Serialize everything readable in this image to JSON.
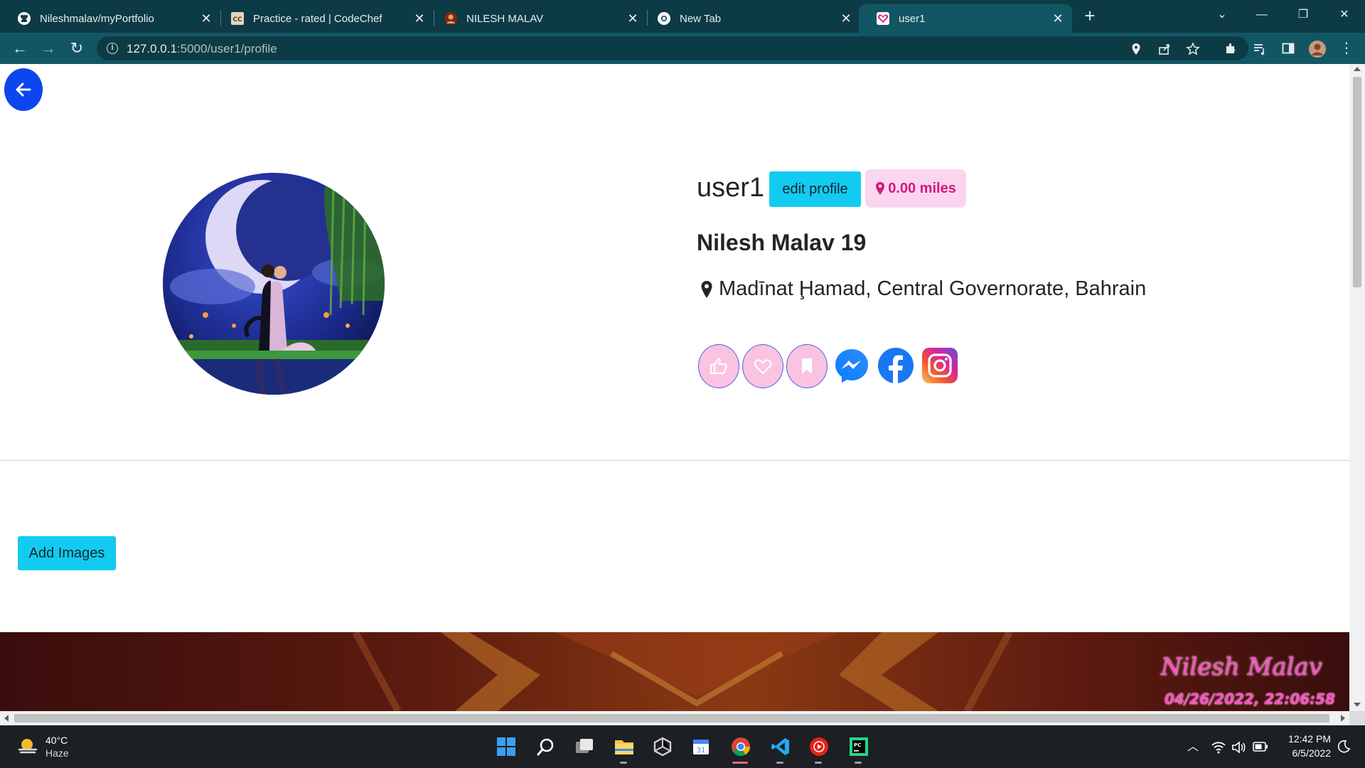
{
  "browser": {
    "tabs": [
      {
        "title": "Nileshmalav/myPortfolio",
        "icon": "github-icon"
      },
      {
        "title": "Practice - rated | CodeChef",
        "icon": "codechef-icon"
      },
      {
        "title": "NILESH MALAV",
        "icon": "portfolio-icon"
      },
      {
        "title": "New Tab",
        "icon": "chrome-icon"
      },
      {
        "title": "user1",
        "icon": "heart-icon",
        "active": true
      }
    ],
    "url_host": "127.0.0.1",
    "url_path": ":5000/user1/profile"
  },
  "profile": {
    "username": "user1",
    "edit_label": "edit profile",
    "distance": "0.00 miles",
    "full_name": "Nilesh Malav 19",
    "location": "Madīnat Ḩamad, Central Governorate, Bahrain",
    "actions": [
      "like-icon",
      "heart-icon",
      "bookmark-icon"
    ],
    "socials": [
      "messenger-icon",
      "facebook-icon",
      "instagram-icon"
    ],
    "add_images_label": "Add Images"
  },
  "footer": {
    "name": "Nilesh Malav",
    "datetime": "04/26/2022, 22:06:58"
  },
  "taskbar": {
    "weather_temp": "40°C",
    "weather_cond": "Haze",
    "time": "12:42 PM",
    "date": "6/5/2022"
  },
  "colors": {
    "accent": "#13cbf0",
    "back_button": "#0d46ee",
    "badge_bg": "#fbd5ef",
    "badge_text": "#d6187c",
    "browser_chrome": "#135663"
  }
}
